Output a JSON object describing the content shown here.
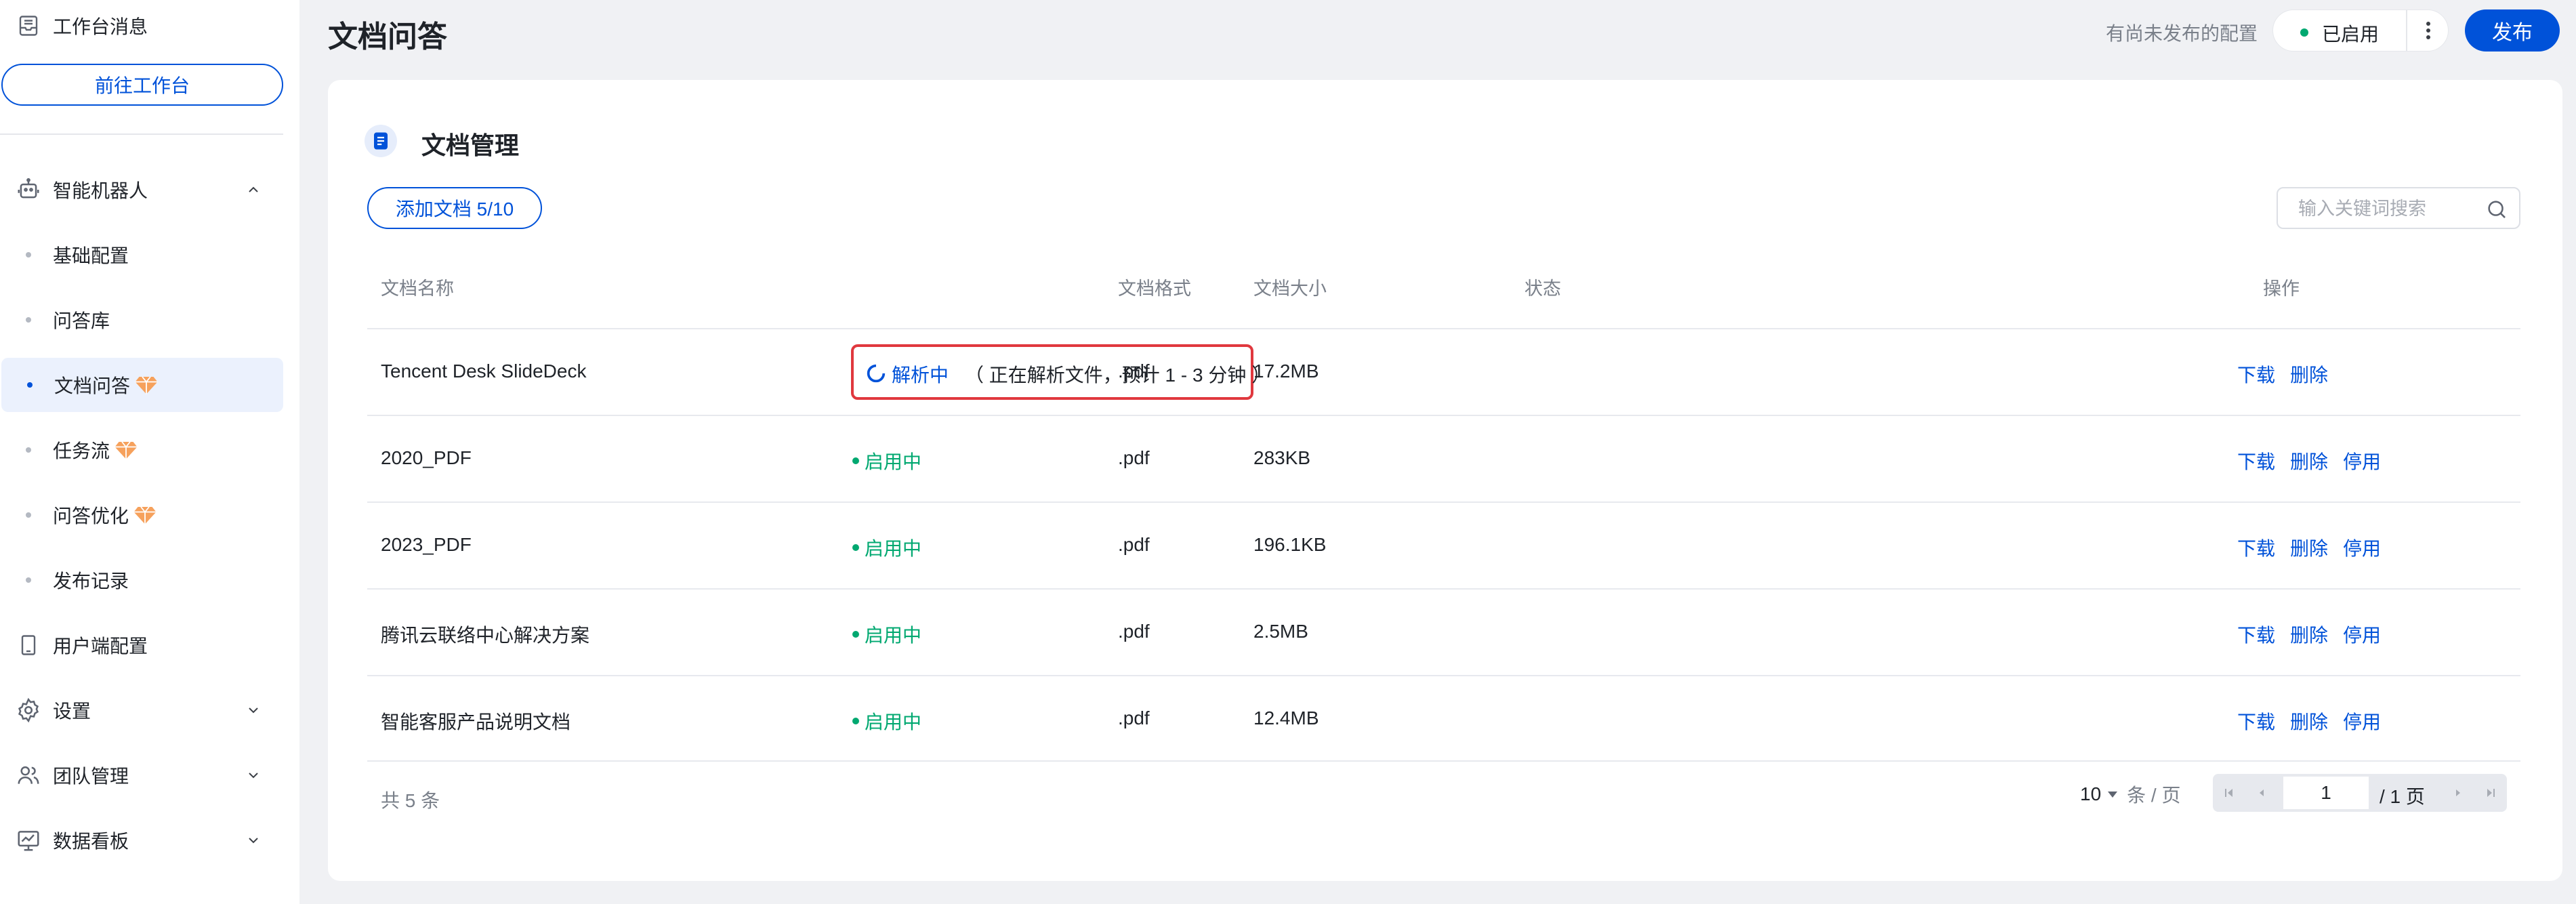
{
  "sidebar": {
    "top_item": "工作台消息",
    "goto_button": "前往工作台",
    "bot_group": "智能机器人",
    "sub_items": [
      "基础配置",
      "问答库",
      "文档问答",
      "任务流",
      "问答优化",
      "发布记录"
    ],
    "items_bottom": [
      "用户端配置",
      "设置",
      "团队管理",
      "数据看板"
    ]
  },
  "header": {
    "title": "文档问答",
    "unpublished_hint": "有尚未发布的配置",
    "status": "已启用",
    "publish": "发布"
  },
  "card": {
    "title": "文档管理",
    "add_button": "添加文档 5/10",
    "search_placeholder": "输入关键词搜索"
  },
  "table": {
    "headers": [
      "文档名称",
      "文档格式",
      "文档大小",
      "状态",
      "操作"
    ],
    "rows": [
      {
        "name": "Tencent Desk SlideDeck",
        "format": ".pdf",
        "size": "17.2MB",
        "status": "解析中",
        "status_detail": "（ 正在解析文件，预计 1 - 3 分钟 ）",
        "actions": [
          "下载",
          "删除"
        ]
      },
      {
        "name": "2020_PDF",
        "format": ".pdf",
        "size": "283KB",
        "status": "启用中",
        "actions": [
          "下载",
          "删除",
          "停用"
        ]
      },
      {
        "name": "2023_PDF",
        "format": ".pdf",
        "size": "196.1KB",
        "status": "启用中",
        "actions": [
          "下载",
          "删除",
          "停用"
        ]
      },
      {
        "name": "腾讯云联络中心解决方案",
        "format": ".pdf",
        "size": "2.5MB",
        "status": "启用中",
        "actions": [
          "下载",
          "删除",
          "停用"
        ]
      },
      {
        "name": "智能客服产品说明文档",
        "format": ".pdf",
        "size": "12.4MB",
        "status": "启用中",
        "actions": [
          "下载",
          "删除",
          "停用"
        ]
      }
    ]
  },
  "pagination": {
    "total": "共 5 条",
    "page_size": "10",
    "unit": "条 / 页",
    "current_page": "1",
    "total_pages": "/ 1 页"
  },
  "colors": {
    "primary": "#0052d9",
    "success": "#00a870",
    "highlight": "#e0383e",
    "premium": "#f08a3c"
  }
}
